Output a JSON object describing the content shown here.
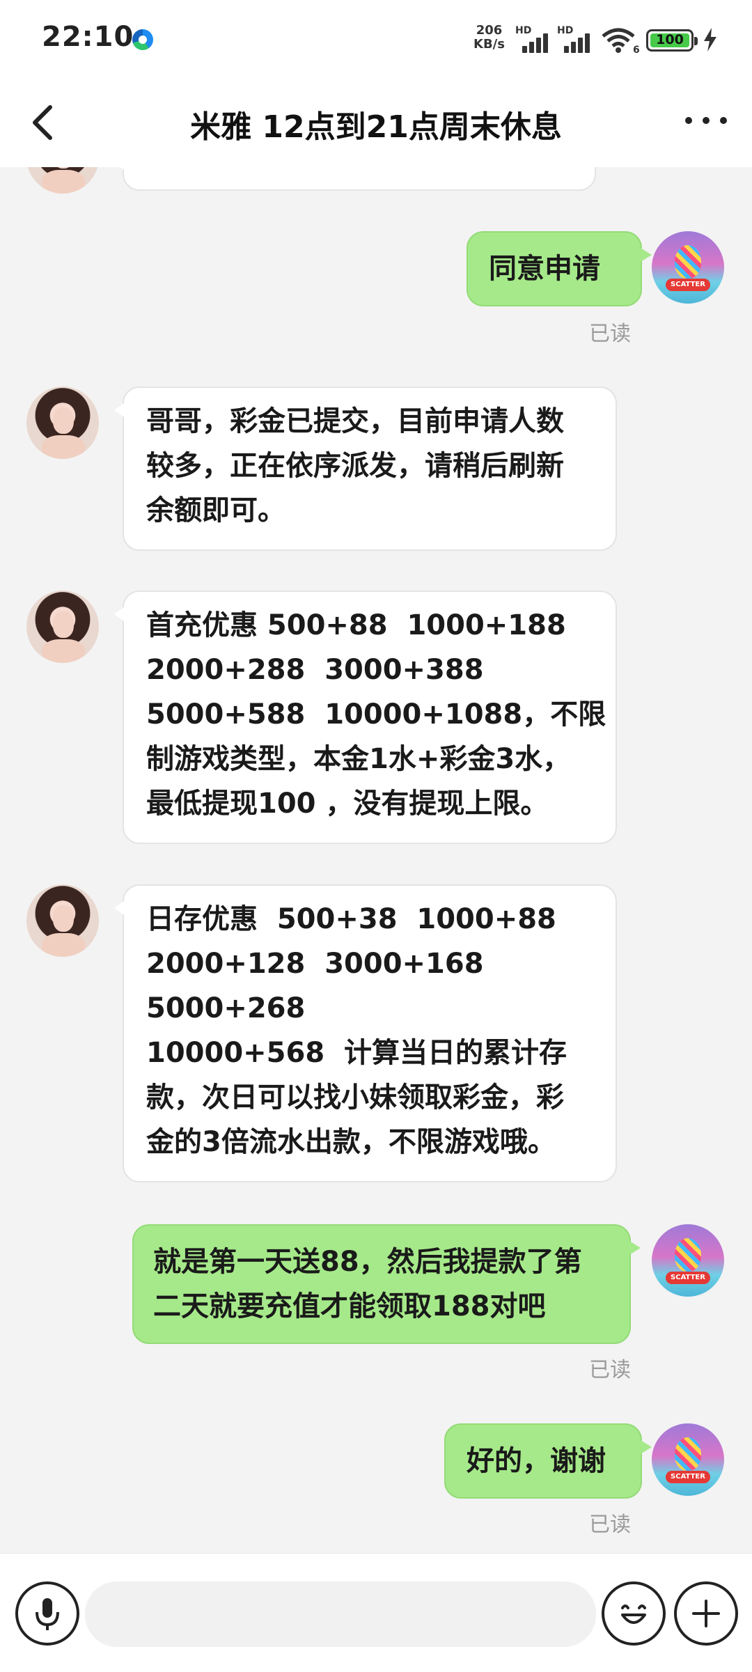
{
  "status_bar": {
    "time": "22:10",
    "net_speed_value": "206",
    "net_speed_unit": "KB/s",
    "sim1_label": "HD",
    "sim2_label": "HD",
    "wifi_label": "6",
    "battery_level": "100",
    "icons": [
      "edge-icon",
      "signal-icon",
      "wifi-icon",
      "battery-icon",
      "charging-icon"
    ]
  },
  "header": {
    "title": "米雅 12点到21点周末休息",
    "back_icon": "chevron-left-icon",
    "more_icon": "more-dots-icon"
  },
  "messages": [
    {
      "side": "out",
      "lines": [
        "同意申请"
      ],
      "status": "已读"
    },
    {
      "side": "in",
      "lines": [
        "哥哥，彩金已提交，目前申请人数",
        "较多，正在依序派发，请稍后刷新",
        "余额即可。"
      ]
    },
    {
      "side": "in",
      "lines": [
        "首充优惠 500+88  1000+188",
        "2000+288  3000+388",
        "5000+588  10000+1088，不限",
        "制游戏类型，本金1水+彩金3水，",
        "最低提现100 ，没有提现上限。"
      ]
    },
    {
      "side": "in",
      "lines": [
        "日存优惠  500+38  1000+88",
        "2000+128  3000+168",
        "5000+268",
        "10000+568  计算当日的累计存",
        "款，次日可以找小妹领取彩金，彩",
        "金的3倍流水出款，不限游戏哦。"
      ]
    },
    {
      "side": "out",
      "lines": [
        "就是第一天送88，然后我提款了第",
        "二天就要充值才能领取188对吧"
      ],
      "status": "已读"
    },
    {
      "side": "out",
      "lines": [
        "好的，谢谢"
      ],
      "status": "已读"
    }
  ],
  "avatar_me_text": "SCATTER",
  "input_bar": {
    "voice_icon": "microphone-icon",
    "emoji_icon": "emoji-icon",
    "add_icon": "plus-icon",
    "placeholder": ""
  },
  "colors": {
    "outgoing_bubble": "#a6e98a",
    "incoming_bubble": "#ffffff",
    "background": "#f3f3f3"
  }
}
